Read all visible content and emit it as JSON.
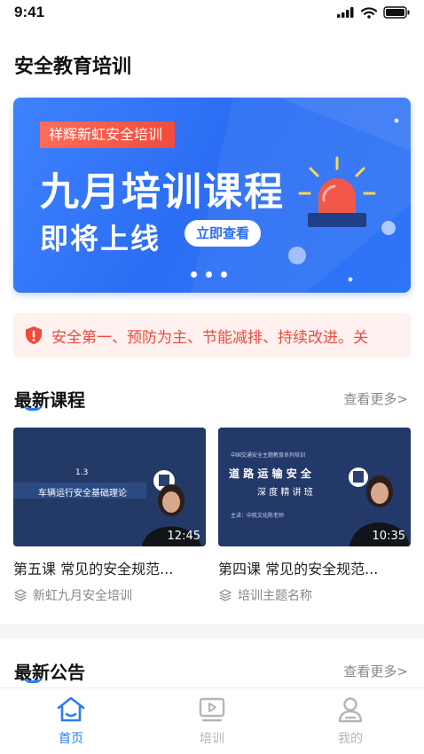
{
  "status_bar": {
    "time": "9:41"
  },
  "page": {
    "title": "安全教育培训"
  },
  "banner": {
    "tag": "祥辉新虹安全培训",
    "title": "九月培训课程",
    "subtitle": "即将上线",
    "button": "立即查看"
  },
  "notice": {
    "text": "安全第一、预防为主、节能减排、持续改进。关"
  },
  "latest_courses": {
    "title": "最新课程",
    "more": "查看更多",
    "items": [
      {
        "slide_number": "1.3",
        "slide_text": "车辆运行安全基础理论",
        "duration": "12:45",
        "title": "第五课 常见的安全规范...",
        "meta": "新虹九月安全培训"
      },
      {
        "slide_heading_top": "中国交通安全主题教育系列培训",
        "slide_heading": "道 路 运 输 安 全",
        "slide_subheading": "深 度 精 讲 班",
        "slide_lecturer": "主讲：中航文化陈老师",
        "duration": "10:35",
        "title": "第四课 常见的安全规范...",
        "meta": "培训主题名称"
      }
    ]
  },
  "latest_notices": {
    "title": "最新公告",
    "more": "查看更多"
  },
  "tabbar": {
    "items": [
      {
        "label": "首页",
        "icon": "home-icon",
        "active": true
      },
      {
        "label": "培训",
        "icon": "play-icon",
        "active": false
      },
      {
        "label": "我的",
        "icon": "user-icon",
        "active": false
      }
    ]
  },
  "colors": {
    "accent": "#2b7bf5",
    "notice": "#ef4a3c",
    "banner": "#2b6ef3"
  }
}
